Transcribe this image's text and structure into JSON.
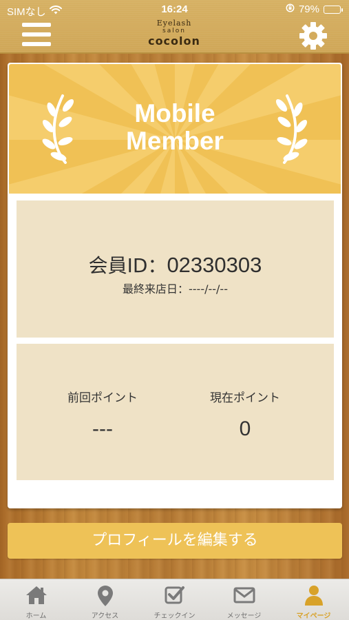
{
  "status_bar": {
    "carrier": "SIMなし",
    "time": "16:24",
    "battery_percent_label": "79%",
    "battery_level": 0.79
  },
  "header": {
    "logo_line1": "Eyelash",
    "logo_line2": "salon",
    "logo_line3": "cocolon",
    "menu_icon": "hamburger-menu-icon",
    "settings_icon": "gear-icon"
  },
  "banner": {
    "title_line1": "Mobile",
    "title_line2": "Member"
  },
  "member": {
    "id_label": "会員ID：",
    "id_value": "02330303",
    "last_visit": "最終来店日：----/--/--"
  },
  "points": {
    "previous_label": "前回ポイント",
    "previous_value": "---",
    "current_label": "現在ポイント",
    "current_value": "0"
  },
  "edit_profile_label": "プロフィールを編集する",
  "tabs": [
    {
      "label": "ホーム",
      "icon": "home-icon",
      "active": false
    },
    {
      "label": "アクセス",
      "icon": "map-pin-icon",
      "active": false
    },
    {
      "label": "チェックイン",
      "icon": "checkbox-icon",
      "active": false
    },
    {
      "label": "メッセージ",
      "icon": "envelope-icon",
      "active": false
    },
    {
      "label": "マイページ",
      "icon": "person-icon",
      "active": true
    }
  ],
  "colors": {
    "header_bg": "#d6b062",
    "banner_bg": "#f0c155",
    "panel_bg": "#efe2c6",
    "accent": "#eec257",
    "active_tab": "#d8a229"
  }
}
